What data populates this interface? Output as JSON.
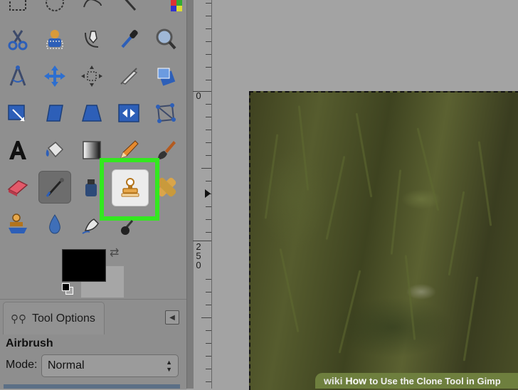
{
  "tool_options": {
    "tab_label": "Tool Options",
    "tool_name": "Airbrush",
    "mode_label": "Mode:",
    "mode_value": "Normal"
  },
  "ruler": {
    "label_0": "0",
    "label_250": [
      "2",
      "5",
      "0"
    ]
  },
  "watermark": {
    "brand": "wiki",
    "how": "How",
    "title": "to Use the Clone Tool in Gimp"
  },
  "colors": {
    "highlight": "#33e81f",
    "foreground": "#000000",
    "background": "#a6a6a6"
  },
  "toolbox_icons": [
    "rect-select-icon",
    "ellipse-select-icon",
    "free-select-icon",
    "fuzzy-select-icon",
    "color-select-icon",
    "scissors-select-icon",
    "foreground-select-icon",
    "paths-icon",
    "color-picker-icon",
    "zoom-icon",
    "measure-icon",
    "move-icon",
    "align-icon",
    "crop-icon",
    "rotate-icon",
    "scale-icon",
    "shear-icon",
    "perspective-icon",
    "flip-icon",
    "cage-transform-icon",
    "text-icon",
    "bucket-fill-icon",
    "blend-icon",
    "pencil-icon",
    "paintbrush-icon",
    "eraser-icon",
    "airbrush-icon",
    "ink-icon",
    "clone-stamp-icon",
    "heal-icon",
    "perspective-clone-icon",
    "blur-icon",
    "smudge-icon",
    "dodge-burn-icon"
  ]
}
